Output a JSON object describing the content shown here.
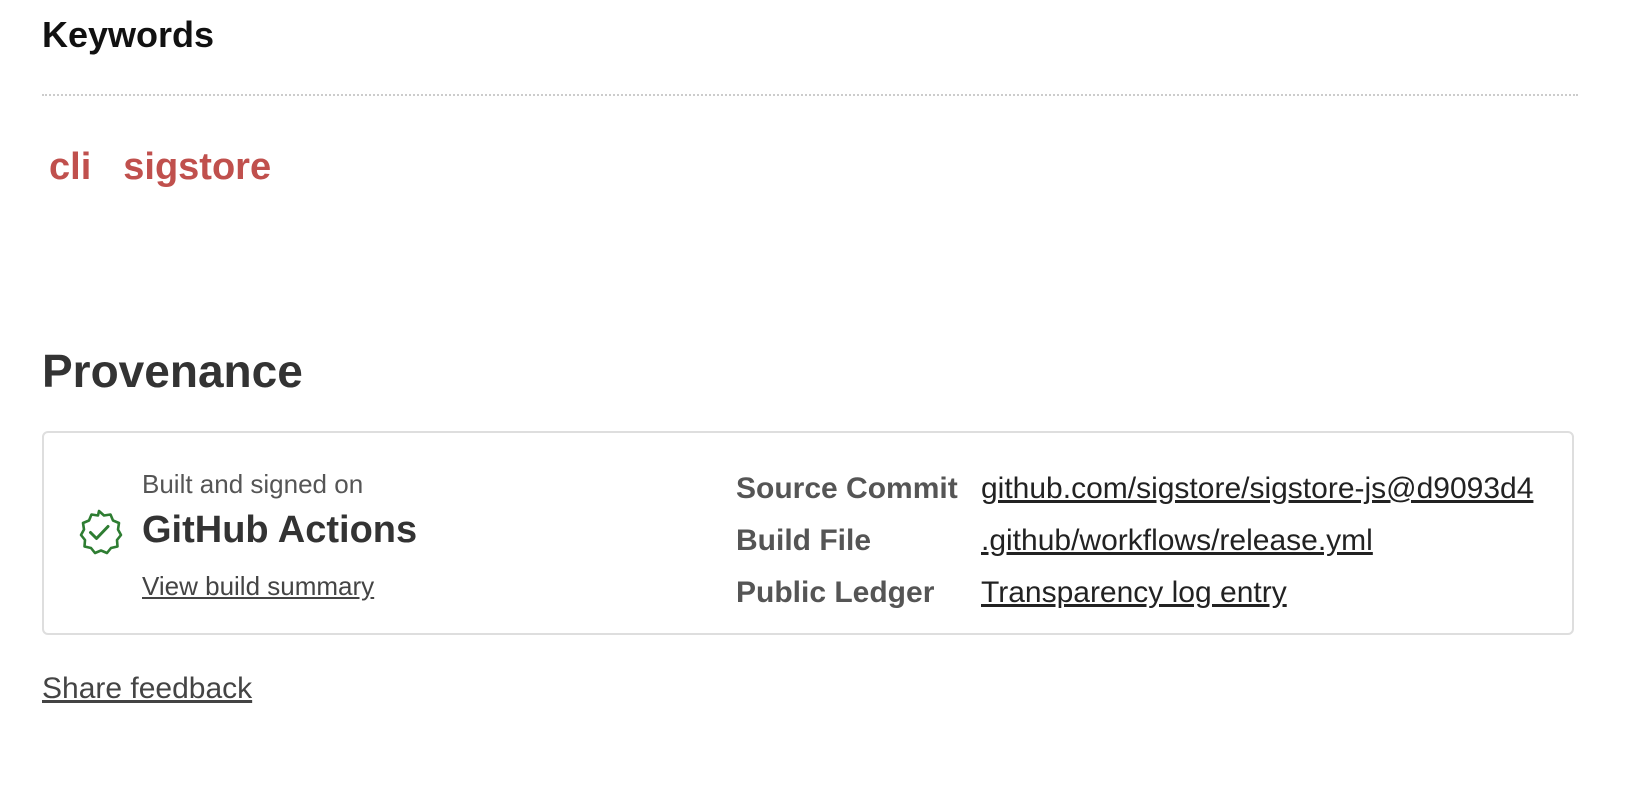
{
  "keywords": {
    "heading": "Keywords",
    "items": [
      "cli",
      "sigstore"
    ]
  },
  "provenance": {
    "heading": "Provenance",
    "built_label": "Built and signed on",
    "builder": "GitHub Actions",
    "summary_link": "View build summary",
    "details": [
      {
        "label": "Source Commit",
        "value": "github.com/sigstore/sigstore-js@d9093d4"
      },
      {
        "label": "Build File",
        "value": ".github/workflows/release.yml"
      },
      {
        "label": "Public Ledger",
        "value": "Transparency log entry"
      }
    ],
    "badge_icon": "verified-check-icon"
  },
  "feedback_link": "Share feedback",
  "colors": {
    "keyword": "#c0504d",
    "badge": "#2e7d32",
    "text": "#333333",
    "border": "#dedede"
  }
}
